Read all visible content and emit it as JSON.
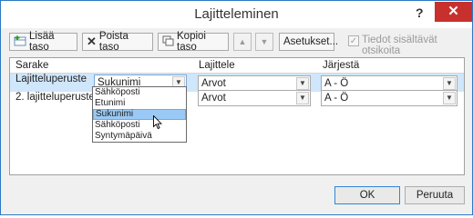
{
  "window": {
    "title": "Lajitteleminen",
    "help_label": "?",
    "close_label": "✕"
  },
  "toolbar": {
    "add_level": "Lisää taso",
    "delete_level": "Poista taso",
    "copy_level": "Kopioi taso",
    "move_up": "▲",
    "move_down": "▼",
    "options": "Asetukset...",
    "headers_checkbox_mark": "✓",
    "headers_checkbox_label": "Tiedot sisältävät otsikoita"
  },
  "grid": {
    "headers": {
      "column": "Sarake",
      "sort_on": "Lajittele",
      "order": "Järjestä"
    },
    "rows": [
      {
        "label": "Lajitteluperuste",
        "column": "Sukunimi",
        "sort_on": "Arvot",
        "order": "A - Ö"
      },
      {
        "label": "2. lajitteluperuste",
        "column": "",
        "sort_on": "Arvot",
        "order": "A - Ö"
      }
    ]
  },
  "dropdown": {
    "options": [
      "Sähköposti",
      "Etunimi",
      "Sukunimi",
      "Sähköposti",
      "Syntymäpäivä"
    ],
    "selected_index": 2
  },
  "footer": {
    "ok": "OK",
    "cancel": "Peruuta"
  }
}
